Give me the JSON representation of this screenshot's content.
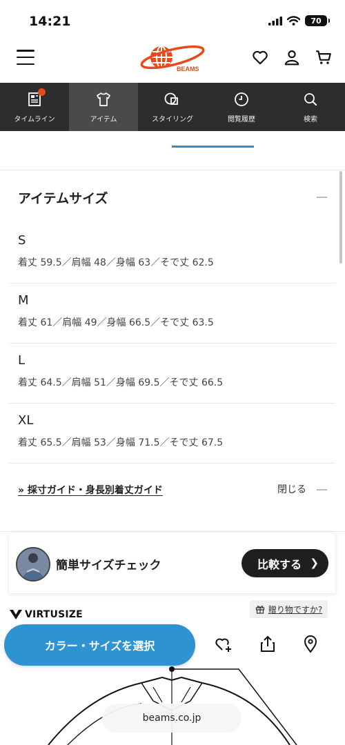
{
  "status_bar": {
    "time": "14:21",
    "battery": "70"
  },
  "header": {
    "logo_text": "BEAMS"
  },
  "nav": {
    "items": [
      {
        "label": "タイムライン",
        "icon": "newspaper-icon"
      },
      {
        "label": "アイテム",
        "icon": "tshirt-icon"
      },
      {
        "label": "スタイリング",
        "icon": "styling-icon"
      },
      {
        "label": "閲覧履歴",
        "icon": "clock-icon"
      },
      {
        "label": "検索",
        "icon": "search-icon"
      }
    ],
    "active_index": 1
  },
  "size_section": {
    "title": "アイテムサイズ",
    "sizes": [
      {
        "name": "S",
        "detail": "着丈 59.5／肩幅 48／身幅 63／そで丈 62.5"
      },
      {
        "name": "M",
        "detail": "着丈 61／肩幅 49／身幅 66.5／そで丈 63.5"
      },
      {
        "name": "L",
        "detail": "着丈 64.5／肩幅 51／身幅 69.5／そで丈 66.5"
      },
      {
        "name": "XL",
        "detail": "着丈 65.5／肩幅 53／身幅 71.5／そで丈 67.5"
      }
    ],
    "guide_link": "» 採寸ガイド・身長別着丈ガイド",
    "close_label": "閉じる"
  },
  "size_check": {
    "title": "簡単サイズチェック",
    "compare_button": "比較する"
  },
  "virtusize": {
    "label": "VIRTUSIZE"
  },
  "gift": {
    "label": "贈り物ですか?"
  },
  "bottom_bar": {
    "select_button": "カラー・サイズを選択"
  },
  "browser": {
    "url": "beams.co.jp"
  },
  "colors": {
    "brand_orange": "#e8491b",
    "accent_blue": "#2f93d1",
    "nav_bg": "#2d2d2d"
  }
}
